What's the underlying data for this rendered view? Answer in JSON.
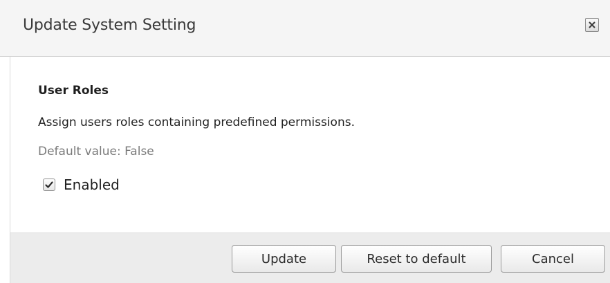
{
  "dialog": {
    "title": "Update System Setting",
    "close_icon": "close-icon"
  },
  "setting": {
    "name": "User Roles",
    "description": "Assign users roles containing predefined permissions.",
    "default_value_text": "Default value: False",
    "checkbox_label": "Enabled",
    "checkbox_checked": true
  },
  "buttons": {
    "update_label": "Update",
    "reset_label": "Reset to default",
    "cancel_label": "Cancel"
  }
}
